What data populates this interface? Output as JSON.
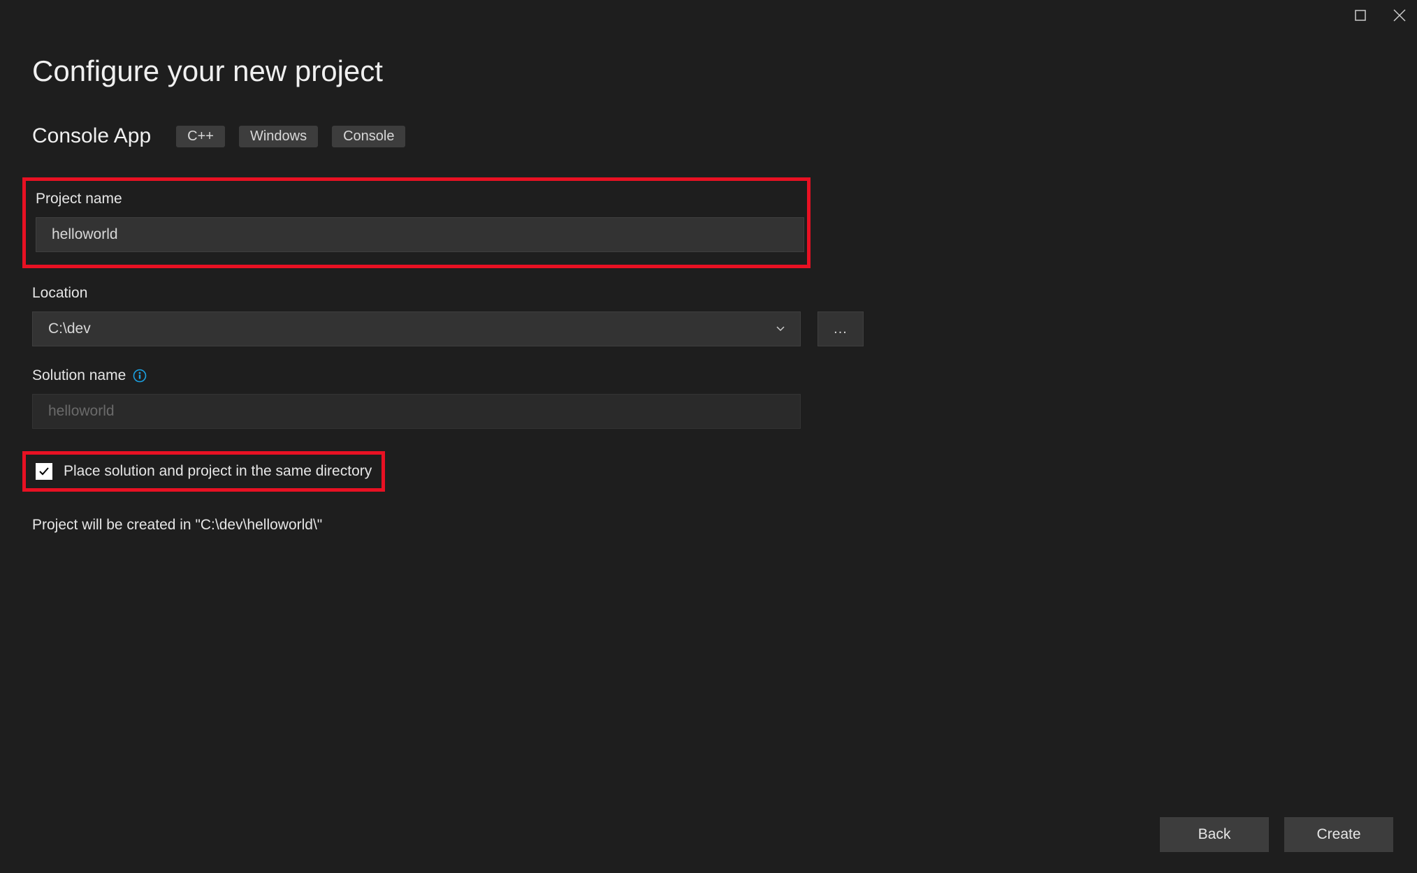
{
  "titlebar": {
    "maximize": "maximize",
    "close": "close"
  },
  "page": {
    "title": "Configure your new project"
  },
  "template": {
    "name": "Console App",
    "tags": [
      "C++",
      "Windows",
      "Console"
    ]
  },
  "form": {
    "project_name_label": "Project name",
    "project_name_value": "helloworld",
    "location_label": "Location",
    "location_value": "C:\\dev",
    "browse_label": "...",
    "solution_name_label": "Solution name",
    "solution_name_placeholder": "helloworld",
    "same_directory_label": "Place solution and project in the same directory",
    "same_directory_checked": true,
    "summary": "Project will be created in \"C:\\dev\\helloworld\\\""
  },
  "footer": {
    "back": "Back",
    "create": "Create"
  }
}
